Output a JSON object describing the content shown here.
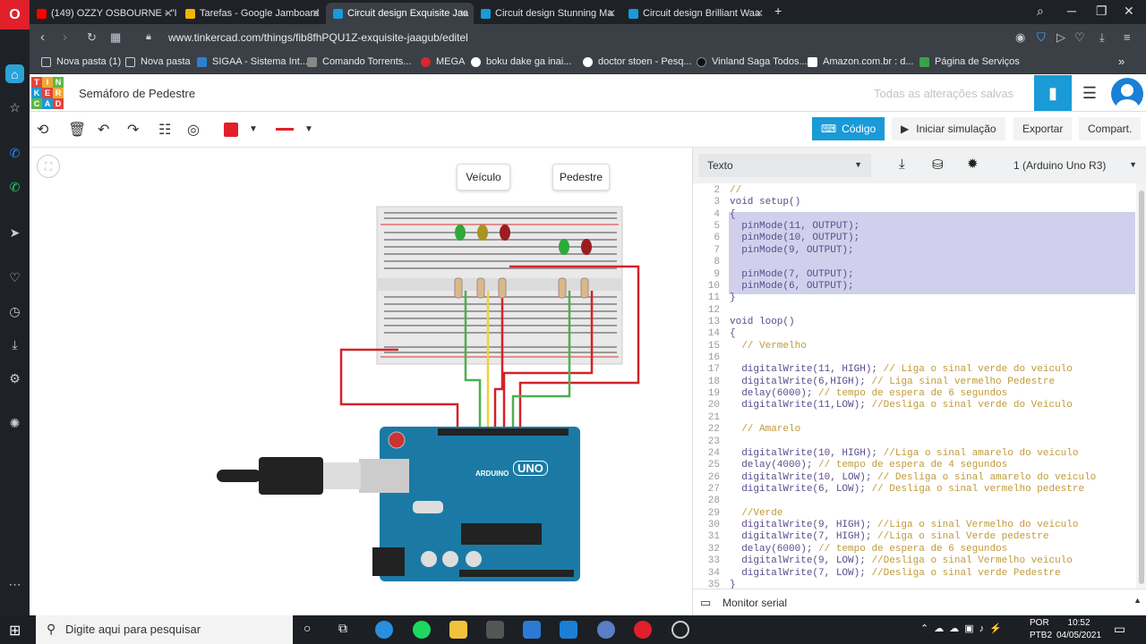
{
  "browser": {
    "tabs": [
      {
        "label": "(149) OZZY OSBOURNE - \"I",
        "color": "#ff0000"
      },
      {
        "label": "Tarefas - Google Jamboard",
        "color": "#f4b400"
      },
      {
        "label": "Circuit design Exquisite Jaa",
        "color": "#1a9ad6"
      },
      {
        "label": "Circuit design Stunning Ma",
        "color": "#1a9ad6"
      },
      {
        "label": "Circuit design Brilliant Waa",
        "color": "#1a9ad6"
      }
    ],
    "url": "www.tinkercad.com/things/fib8fhPQU1Z-exquisite-jaagub/editel",
    "bookmarks": [
      "Nova pasta (1)",
      "Nova pasta",
      "SIGAA - Sistema Int...",
      "Comando Torrents...",
      "MEGA",
      "boku dake ga inai...",
      "doctor stoen - Pesq...",
      "Vinland Saga Todos...",
      "Amazon.com.br : d...",
      "Página de Serviços"
    ]
  },
  "header": {
    "logo_letters": [
      "T",
      "I",
      "N",
      "K",
      "E",
      "R",
      "C",
      "A",
      "D"
    ],
    "project_title": "Semáforo de Pedestre",
    "save_status": "Todas as alterações salvas"
  },
  "toolbar": {
    "code_label": "Código",
    "simulate_label": "Iniciar simulação",
    "export_label": "Exportar",
    "share_label": "Compart."
  },
  "canvas": {
    "label_vehicle": "Veículo",
    "label_pedestrian": "Pedestre",
    "board_brand": "ARDUINO",
    "board_model": "UNO"
  },
  "code_panel": {
    "mode": "Texto",
    "device": "1 (Arduino Uno R3)",
    "monitor_label": "Monitor serial",
    "lines": [
      {
        "n": "2",
        "t": "//"
      },
      {
        "n": "3",
        "t": "void setup()"
      },
      {
        "n": "4",
        "t": "{"
      },
      {
        "n": "5",
        "t": "  pinMode(11, OUTPUT);"
      },
      {
        "n": "6",
        "t": "  pinMode(10, OUTPUT);"
      },
      {
        "n": "7",
        "t": "  pinMode(9, OUTPUT);"
      },
      {
        "n": "8",
        "t": ""
      },
      {
        "n": "9",
        "t": "  pinMode(7, OUTPUT);"
      },
      {
        "n": "10",
        "t": "  pinMode(6, OUTPUT);"
      },
      {
        "n": "11",
        "t": "}"
      },
      {
        "n": "12",
        "t": ""
      },
      {
        "n": "13",
        "t": "void loop()"
      },
      {
        "n": "14",
        "t": "{"
      },
      {
        "n": "15",
        "t": "  // Vermelho"
      },
      {
        "n": "16",
        "t": ""
      },
      {
        "n": "17",
        "t": "  digitalWrite(11, HIGH); // Liga o sinal verde do veiculo"
      },
      {
        "n": "18",
        "t": "  digitalWrite(6,HIGH); // Liga sinal vermelho Pedestre"
      },
      {
        "n": "19",
        "t": "  delay(6000); // tempo de espera de 6 segundos"
      },
      {
        "n": "20",
        "t": "  digitalWrite(11,LOW); //Desliga o sinal verde do Veiculo"
      },
      {
        "n": "21",
        "t": ""
      },
      {
        "n": "22",
        "t": "  // Amarelo"
      },
      {
        "n": "23",
        "t": ""
      },
      {
        "n": "24",
        "t": "  digitalWrite(10, HIGH); //Liga o sinal amarelo do veiculo"
      },
      {
        "n": "25",
        "t": "  delay(4000); // tempo de espera de 4 segundos"
      },
      {
        "n": "26",
        "t": "  digitalWrite(10, LOW); // Desliga o sinal amarelo do veiculo"
      },
      {
        "n": "27",
        "t": "  digitalWrite(6, LOW); // Desliga o sinal vermelho pedestre"
      },
      {
        "n": "28",
        "t": ""
      },
      {
        "n": "29",
        "t": "  //Verde"
      },
      {
        "n": "30",
        "t": "  digitalWrite(9, HIGH); //Liga o sinal Vermelho do veiculo"
      },
      {
        "n": "31",
        "t": "  digitalWrite(7, HIGH); //Liga o sinal Verde pedestre"
      },
      {
        "n": "32",
        "t": "  delay(6000); // tempo de espera de 6 segundos"
      },
      {
        "n": "33",
        "t": "  digitalWrite(9, LOW); //Desliga o sinal Vermelho veiculo"
      },
      {
        "n": "34",
        "t": "  digitalWrite(7, LOW); //Desliga o sinal verde Pedestre"
      },
      {
        "n": "35",
        "t": "}"
      }
    ]
  },
  "taskbar": {
    "search_placeholder": "Digite aqui para pesquisar",
    "lang": "POR",
    "layout": "PTB2",
    "time": "10:52",
    "date": "04/05/2021"
  },
  "colors": {
    "accent": "#1a9ad6",
    "opera": "#e0202a"
  }
}
